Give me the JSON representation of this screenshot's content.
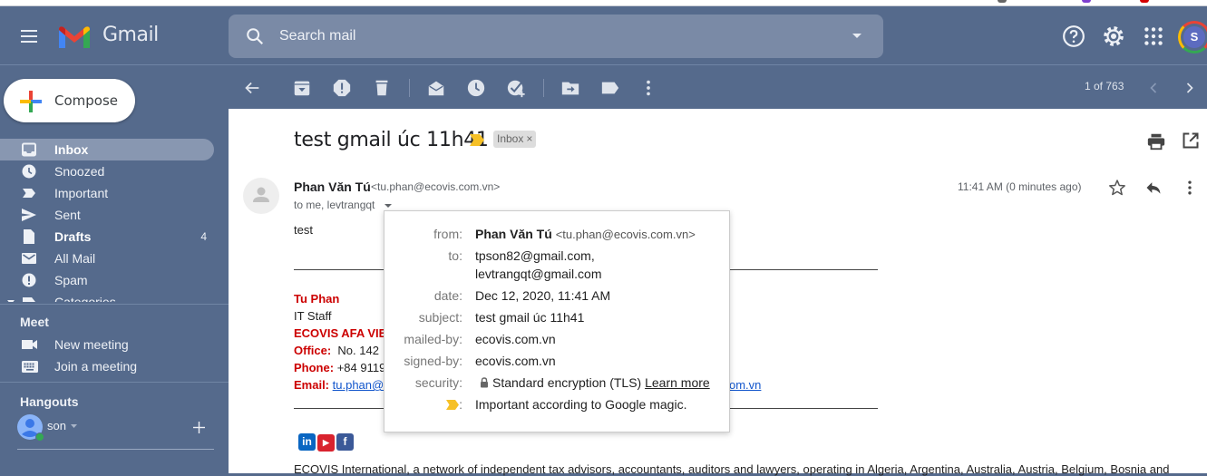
{
  "app": {
    "logo_text": "Gmail",
    "colors": {
      "header_bg": "#556a8c",
      "accent_red": "#cc0000",
      "link": "#1155cc",
      "important_marker": "#f6c026"
    }
  },
  "header": {
    "search_placeholder": "Search mail",
    "icons": [
      "menu-icon",
      "search-icon",
      "search-options-caret-icon",
      "help-icon",
      "settings-icon",
      "apps-icon"
    ],
    "account_initial": "S"
  },
  "sidebar": {
    "compose_label": "Compose",
    "items": [
      {
        "label": "Inbox",
        "icon": "inbox-icon",
        "active": true,
        "bold": true,
        "count": ""
      },
      {
        "label": "Snoozed",
        "icon": "clock-icon",
        "count": ""
      },
      {
        "label": "Important",
        "icon": "important-icon",
        "count": ""
      },
      {
        "label": "Sent",
        "icon": "send-icon",
        "count": ""
      },
      {
        "label": "Drafts",
        "icon": "draft-icon",
        "bold": true,
        "count": "4"
      },
      {
        "label": "All Mail",
        "icon": "mail-icon",
        "count": ""
      },
      {
        "label": "Spam",
        "icon": "spam-icon",
        "count": ""
      },
      {
        "label": "Categories",
        "icon": "label-icon",
        "count": ""
      }
    ],
    "meet": {
      "title": "Meet",
      "new_meeting": "New meeting",
      "join_meeting": "Join a meeting"
    },
    "hangouts": {
      "title": "Hangouts",
      "user": "son"
    }
  },
  "toolbar": {
    "actions": [
      "back",
      "archive",
      "report-spam",
      "delete",
      "mark-unread",
      "snooze",
      "add-to-tasks",
      "move-to",
      "labels",
      "more"
    ],
    "pager_text": "1 of 763"
  },
  "message": {
    "subject": "test gmail úc 11h41",
    "label": "Inbox",
    "label_remove": "×",
    "sender_name": "Phan Văn Tú",
    "sender_email": "<tu.phan@ecovis.com.vn>",
    "to_line": "to me, levtrangqt",
    "time": "11:41 AM (0 minutes ago)",
    "body": "test",
    "signature": {
      "name": "Tu Phan",
      "title": "IT Staff",
      "company": "ECOVIS AFA VIE",
      "office_label": "Office:",
      "office_value": "No. 142",
      "phone_label": "Phone:",
      "phone_value": "+84 9119",
      "email_label": "Email:",
      "email_value": "tu.phan@",
      "email_tail": "om.vn"
    },
    "social": [
      "in",
      "▶",
      "f"
    ],
    "footer": "ECOVIS International, a network of independent tax advisors, accountants, auditors and lawyers, operating in Algeria, Argentina, Australia, Austria, Belgium, Bosnia and"
  },
  "details_popup": {
    "rows": [
      {
        "key": "from:",
        "name": "Phan Văn Tú",
        "email": "<tu.phan@ecovis.com.vn>"
      },
      {
        "key": "to:",
        "value": "tpson82@gmail.com,",
        "value2": "levtrangqt@gmail.com"
      },
      {
        "key": "date:",
        "value": "Dec 12, 2020, 11:41 AM"
      },
      {
        "key": "subject:",
        "value": "test gmail úc 11h41"
      },
      {
        "key": "mailed-by:",
        "value": "ecovis.com.vn"
      },
      {
        "key": "signed-by:",
        "value": "ecovis.com.vn"
      },
      {
        "key": "security:",
        "value": "Standard encryption (TLS)",
        "link": "Learn more"
      },
      {
        "key": ":",
        "value": "Important according to Google magic."
      }
    ]
  }
}
